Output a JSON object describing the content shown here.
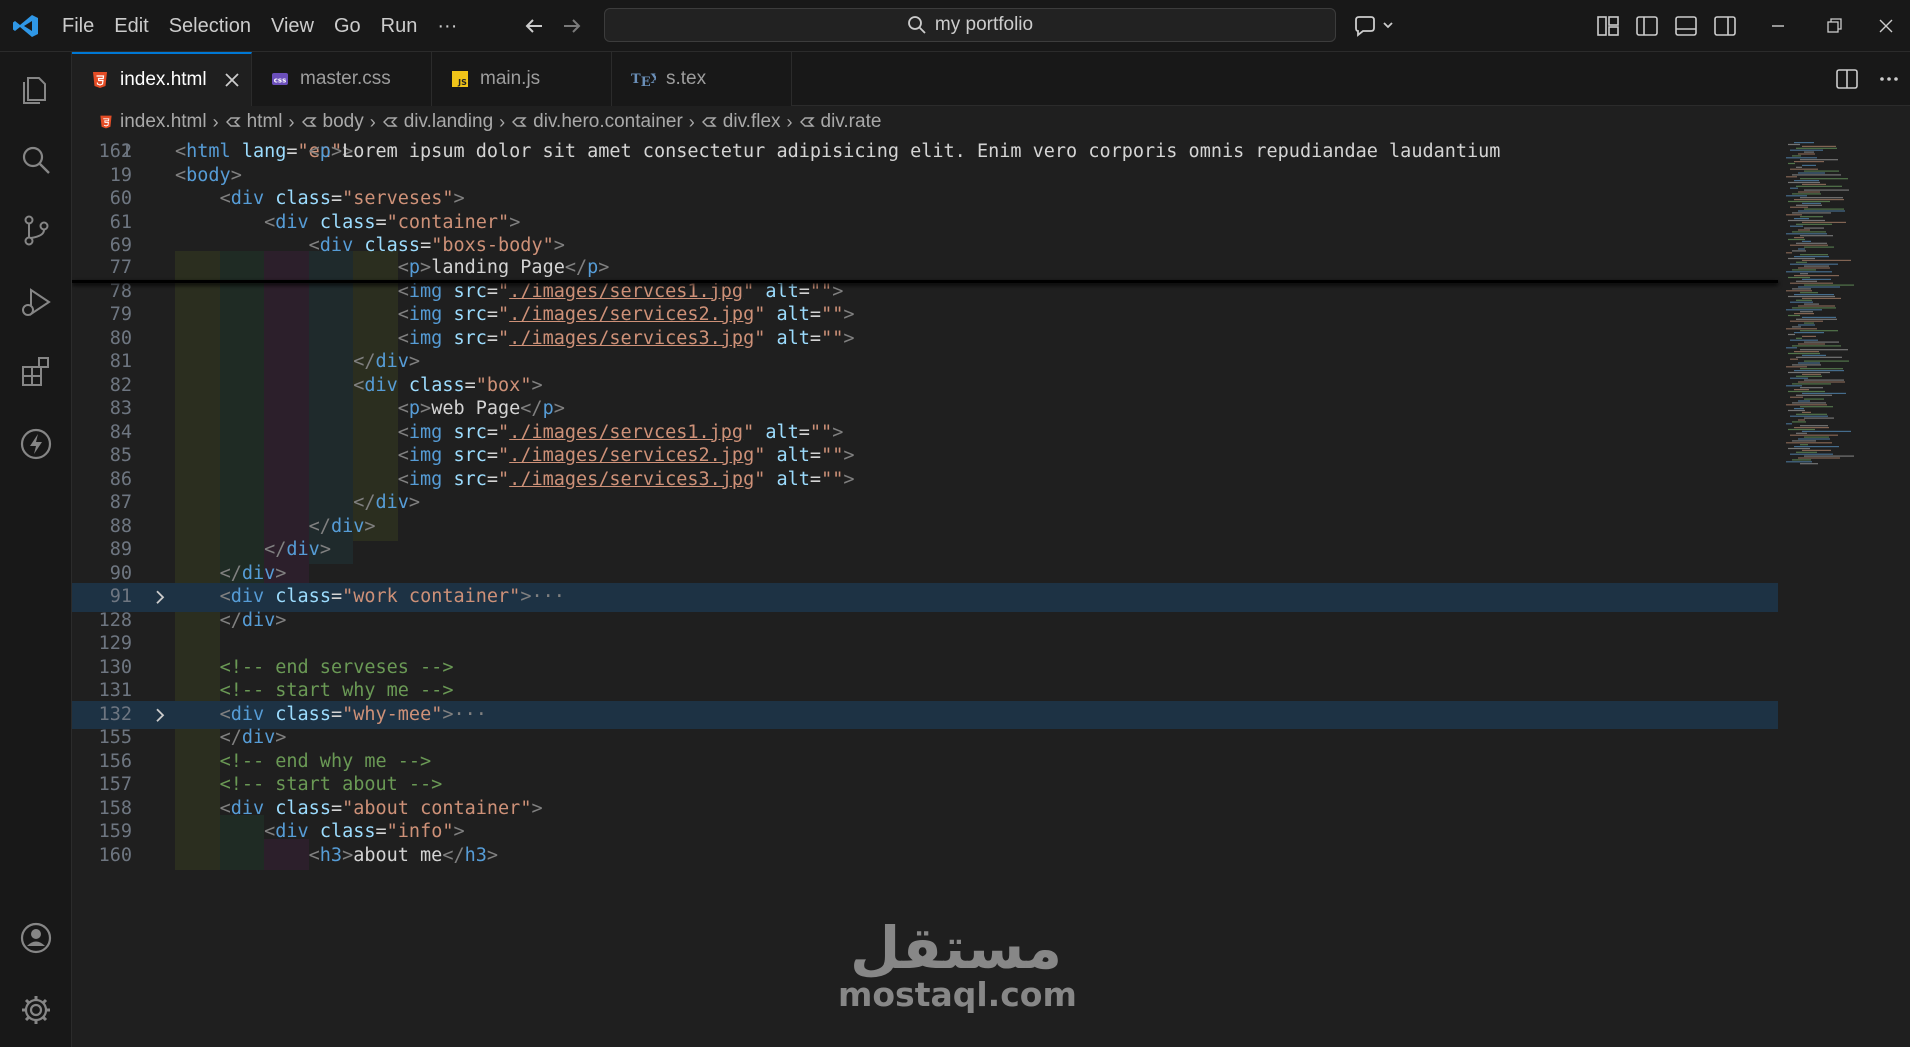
{
  "menu": [
    "File",
    "Edit",
    "Selection",
    "View",
    "Go",
    "Run",
    "···"
  ],
  "search": {
    "text": "my portfolio"
  },
  "tabs": [
    {
      "label": "index.html",
      "icon": "html5-icon",
      "active": true
    },
    {
      "label": "master.css",
      "icon": "css-icon",
      "active": false
    },
    {
      "label": "main.js",
      "icon": "js-icon",
      "active": false
    },
    {
      "label": "s.tex",
      "icon": "tex-icon",
      "active": false
    }
  ],
  "breadcrumb": [
    "index.html",
    "html",
    "body",
    "div.landing",
    "div.hero.container",
    "div.flex",
    "div.rate"
  ],
  "watermark": {
    "ar": "مستقل",
    "en": "mostaql.com"
  },
  "colors": {
    "accent": "#0078d4",
    "tag": "#569cd6",
    "attr": "#9cdcfe",
    "string": "#ce9178",
    "comment": "#6a9955"
  },
  "code_lines": [
    {
      "n": "2",
      "parts": [
        [
          "tg",
          "<"
        ],
        [
          "t",
          "html"
        ],
        [
          "x",
          " "
        ],
        [
          "a",
          "lang"
        ],
        [
          "x",
          "="
        ],
        [
          "s",
          "\"en\""
        ],
        [
          "tg",
          ">"
        ]
      ]
    },
    {
      "n": "19",
      "parts": [
        [
          "tg",
          "<"
        ],
        [
          "t",
          "body"
        ],
        [
          "tg",
          ">"
        ]
      ]
    },
    {
      "n": "60",
      "parts": [
        [
          "x",
          "    "
        ],
        [
          "tg",
          "<"
        ],
        [
          "t",
          "div"
        ],
        [
          "x",
          " "
        ],
        [
          "a",
          "class"
        ],
        [
          "x",
          "="
        ],
        [
          "s",
          "\"serveses\""
        ],
        [
          "tg",
          ">"
        ]
      ]
    },
    {
      "n": "61",
      "parts": [
        [
          "x",
          "        "
        ],
        [
          "tg",
          "<"
        ],
        [
          "t",
          "div"
        ],
        [
          "x",
          " "
        ],
        [
          "a",
          "class"
        ],
        [
          "x",
          "="
        ],
        [
          "s",
          "\"container\""
        ],
        [
          "tg",
          ">"
        ]
      ]
    },
    {
      "n": "69",
      "parts": [
        [
          "x",
          "            "
        ],
        [
          "tg",
          "<"
        ],
        [
          "t",
          "div"
        ],
        [
          "x",
          " "
        ],
        [
          "a",
          "class"
        ],
        [
          "x",
          "="
        ],
        [
          "s",
          "\"boxs-body\""
        ],
        [
          "tg",
          ">"
        ]
      ]
    },
    {
      "n": "77",
      "parts": [
        [
          "x",
          "                    "
        ],
        [
          "tg",
          "<"
        ],
        [
          "t",
          "p"
        ],
        [
          "tg",
          ">"
        ],
        [
          "x",
          "landing Page"
        ],
        [
          "tg",
          "</"
        ],
        [
          "t",
          "p"
        ],
        [
          "tg",
          ">"
        ]
      ]
    },
    {
      "n": "78",
      "parts": [
        [
          "x",
          "                    "
        ],
        [
          "tg",
          "<"
        ],
        [
          "t",
          "img"
        ],
        [
          "x",
          " "
        ],
        [
          "a",
          "src"
        ],
        [
          "x",
          "="
        ],
        [
          "s",
          "\""
        ],
        [
          "su",
          "./images/servces1.jpg"
        ],
        [
          "s",
          "\""
        ],
        [
          "x",
          " "
        ],
        [
          "a",
          "alt"
        ],
        [
          "x",
          "="
        ],
        [
          "s",
          "\"\""
        ],
        [
          "tg",
          ">"
        ]
      ]
    },
    {
      "n": "79",
      "parts": [
        [
          "x",
          "                    "
        ],
        [
          "tg",
          "<"
        ],
        [
          "t",
          "img"
        ],
        [
          "x",
          " "
        ],
        [
          "a",
          "src"
        ],
        [
          "x",
          "="
        ],
        [
          "s",
          "\""
        ],
        [
          "su",
          "./images/services2.jpg"
        ],
        [
          "s",
          "\""
        ],
        [
          "x",
          " "
        ],
        [
          "a",
          "alt"
        ],
        [
          "x",
          "="
        ],
        [
          "s",
          "\"\""
        ],
        [
          "tg",
          ">"
        ]
      ]
    },
    {
      "n": "80",
      "parts": [
        [
          "x",
          "                    "
        ],
        [
          "tg",
          "<"
        ],
        [
          "t",
          "img"
        ],
        [
          "x",
          " "
        ],
        [
          "a",
          "src"
        ],
        [
          "x",
          "="
        ],
        [
          "s",
          "\""
        ],
        [
          "su",
          "./images/services3.jpg"
        ],
        [
          "s",
          "\""
        ],
        [
          "x",
          " "
        ],
        [
          "a",
          "alt"
        ],
        [
          "x",
          "="
        ],
        [
          "s",
          "\"\""
        ],
        [
          "tg",
          ">"
        ]
      ]
    },
    {
      "n": "81",
      "parts": [
        [
          "x",
          "                "
        ],
        [
          "tg",
          "</"
        ],
        [
          "t",
          "div"
        ],
        [
          "tg",
          ">"
        ]
      ]
    },
    {
      "n": "82",
      "parts": [
        [
          "x",
          "                "
        ],
        [
          "tg",
          "<"
        ],
        [
          "t",
          "div"
        ],
        [
          "x",
          " "
        ],
        [
          "a",
          "class"
        ],
        [
          "x",
          "="
        ],
        [
          "s",
          "\"box\""
        ],
        [
          "tg",
          ">"
        ]
      ]
    },
    {
      "n": "83",
      "parts": [
        [
          "x",
          "                    "
        ],
        [
          "tg",
          "<"
        ],
        [
          "t",
          "p"
        ],
        [
          "tg",
          ">"
        ],
        [
          "x",
          "web Page"
        ],
        [
          "tg",
          "</"
        ],
        [
          "t",
          "p"
        ],
        [
          "tg",
          ">"
        ]
      ]
    },
    {
      "n": "84",
      "parts": [
        [
          "x",
          "                    "
        ],
        [
          "tg",
          "<"
        ],
        [
          "t",
          "img"
        ],
        [
          "x",
          " "
        ],
        [
          "a",
          "src"
        ],
        [
          "x",
          "="
        ],
        [
          "s",
          "\""
        ],
        [
          "su",
          "./images/servces1.jpg"
        ],
        [
          "s",
          "\""
        ],
        [
          "x",
          " "
        ],
        [
          "a",
          "alt"
        ],
        [
          "x",
          "="
        ],
        [
          "s",
          "\"\""
        ],
        [
          "tg",
          ">"
        ]
      ]
    },
    {
      "n": "85",
      "parts": [
        [
          "x",
          "                    "
        ],
        [
          "tg",
          "<"
        ],
        [
          "t",
          "img"
        ],
        [
          "x",
          " "
        ],
        [
          "a",
          "src"
        ],
        [
          "x",
          "="
        ],
        [
          "s",
          "\""
        ],
        [
          "su",
          "./images/services2.jpg"
        ],
        [
          "s",
          "\""
        ],
        [
          "x",
          " "
        ],
        [
          "a",
          "alt"
        ],
        [
          "x",
          "="
        ],
        [
          "s",
          "\"\""
        ],
        [
          "tg",
          ">"
        ]
      ]
    },
    {
      "n": "86",
      "parts": [
        [
          "x",
          "                    "
        ],
        [
          "tg",
          "<"
        ],
        [
          "t",
          "img"
        ],
        [
          "x",
          " "
        ],
        [
          "a",
          "src"
        ],
        [
          "x",
          "="
        ],
        [
          "s",
          "\""
        ],
        [
          "su",
          "./images/services3.jpg"
        ],
        [
          "s",
          "\""
        ],
        [
          "x",
          " "
        ],
        [
          "a",
          "alt"
        ],
        [
          "x",
          "="
        ],
        [
          "s",
          "\"\""
        ],
        [
          "tg",
          ">"
        ]
      ]
    },
    {
      "n": "87",
      "parts": [
        [
          "x",
          "                "
        ],
        [
          "tg",
          "</"
        ],
        [
          "t",
          "div"
        ],
        [
          "tg",
          ">"
        ]
      ]
    },
    {
      "n": "88",
      "parts": [
        [
          "x",
          "            "
        ],
        [
          "tg",
          "</"
        ],
        [
          "t",
          "div"
        ],
        [
          "tg",
          ">"
        ]
      ]
    },
    {
      "n": "89",
      "parts": [
        [
          "x",
          "        "
        ],
        [
          "tg",
          "</"
        ],
        [
          "t",
          "div"
        ],
        [
          "tg",
          ">"
        ]
      ]
    },
    {
      "n": "90",
      "parts": [
        [
          "x",
          "    "
        ],
        [
          "tg",
          "</"
        ],
        [
          "t",
          "div"
        ],
        [
          "tg",
          ">"
        ]
      ]
    },
    {
      "n": "91",
      "fold": true,
      "hl": true,
      "parts": [
        [
          "x",
          "    "
        ],
        [
          "tg",
          "<"
        ],
        [
          "t",
          "div"
        ],
        [
          "x",
          " "
        ],
        [
          "a",
          "class"
        ],
        [
          "x",
          "="
        ],
        [
          "s",
          "\"work container\""
        ],
        [
          "tg",
          ">"
        ],
        [
          "tg",
          "···"
        ]
      ]
    },
    {
      "n": "128",
      "parts": [
        [
          "x",
          "    "
        ],
        [
          "tg",
          "</"
        ],
        [
          "t",
          "div"
        ],
        [
          "tg",
          ">"
        ]
      ]
    },
    {
      "n": "129",
      "parts": []
    },
    {
      "n": "130",
      "parts": [
        [
          "x",
          "    "
        ],
        [
          "c",
          "<!-- end serveses -->"
        ]
      ]
    },
    {
      "n": "131",
      "parts": [
        [
          "x",
          "    "
        ],
        [
          "c",
          "<!-- start why me -->"
        ]
      ]
    },
    {
      "n": "132",
      "fold": true,
      "hl": true,
      "parts": [
        [
          "x",
          "    "
        ],
        [
          "tg",
          "<"
        ],
        [
          "t",
          "div"
        ],
        [
          "x",
          " "
        ],
        [
          "a",
          "class"
        ],
        [
          "x",
          "="
        ],
        [
          "s",
          "\"why-mee\""
        ],
        [
          "tg",
          ">"
        ],
        [
          "tg",
          "···"
        ]
      ]
    },
    {
      "n": "155",
      "parts": [
        [
          "x",
          "    "
        ],
        [
          "tg",
          "</"
        ],
        [
          "t",
          "div"
        ],
        [
          "tg",
          ">"
        ]
      ]
    },
    {
      "n": "156",
      "parts": [
        [
          "x",
          "    "
        ],
        [
          "c",
          "<!-- end why me -->"
        ]
      ]
    },
    {
      "n": "157",
      "parts": [
        [
          "x",
          "    "
        ],
        [
          "c",
          "<!-- start about -->"
        ]
      ]
    },
    {
      "n": "158",
      "parts": [
        [
          "x",
          "    "
        ],
        [
          "tg",
          "<"
        ],
        [
          "t",
          "div"
        ],
        [
          "x",
          " "
        ],
        [
          "a",
          "class"
        ],
        [
          "x",
          "="
        ],
        [
          "s",
          "\"about container\""
        ],
        [
          "tg",
          ">"
        ]
      ]
    },
    {
      "n": "159",
      "parts": [
        [
          "x",
          "        "
        ],
        [
          "tg",
          "<"
        ],
        [
          "t",
          "div"
        ],
        [
          "x",
          " "
        ],
        [
          "a",
          "class"
        ],
        [
          "x",
          "="
        ],
        [
          "s",
          "\"info\""
        ],
        [
          "tg",
          ">"
        ]
      ]
    },
    {
      "n": "160",
      "parts": [
        [
          "x",
          "            "
        ],
        [
          "tg",
          "<"
        ],
        [
          "t",
          "h3"
        ],
        [
          "tg",
          ">"
        ],
        [
          "x",
          "about me"
        ],
        [
          "tg",
          "</"
        ],
        [
          "t",
          "h3"
        ],
        [
          "tg",
          ">"
        ]
      ]
    },
    {
      "n": "161",
      "parts": [
        [
          "x",
          "            "
        ],
        [
          "tg",
          "<"
        ],
        [
          "t",
          "p"
        ],
        [
          "tg",
          ">"
        ],
        [
          "x",
          "Lorem ipsum dolor sit amet consectetur adipisicing elit. Enim vero corporis omnis repudiandae laudantium"
        ]
      ]
    }
  ]
}
